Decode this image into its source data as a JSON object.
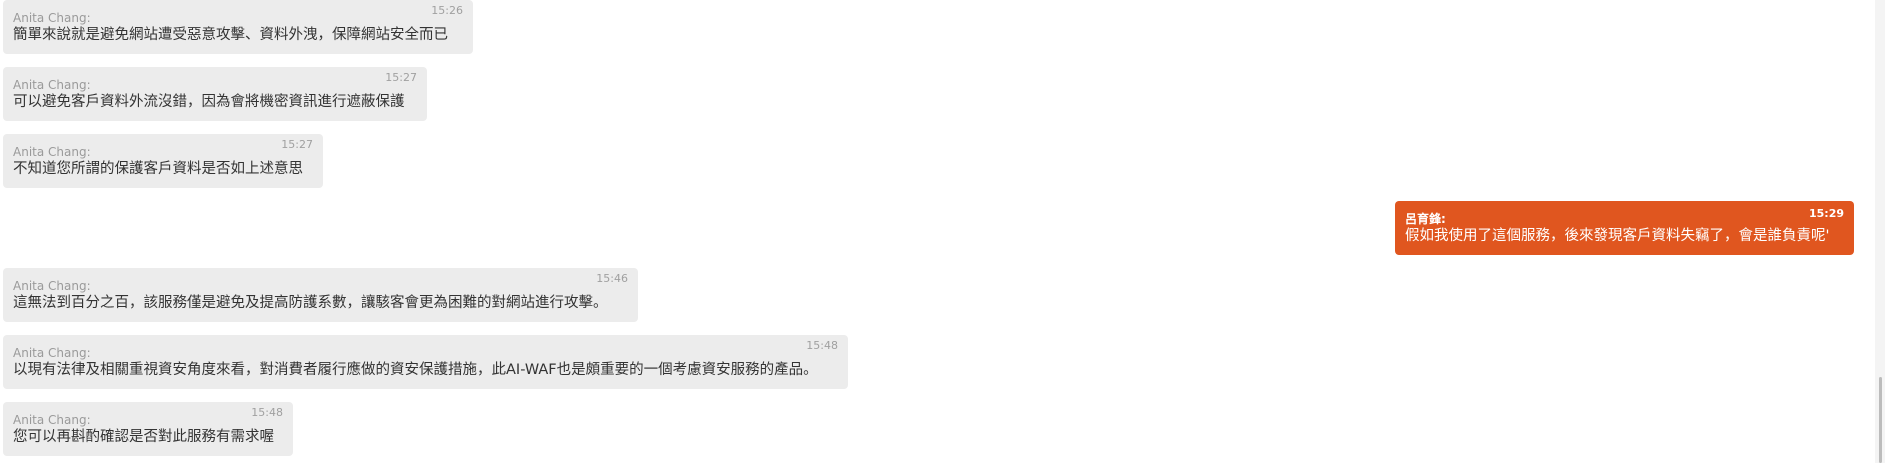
{
  "messages": [
    {
      "sender": "Anita Chang:",
      "time": "15:26",
      "text": "簡單來說就是避免網站遭受惡意攻擊、資料外洩，保障網站安全而已",
      "direction": "in"
    },
    {
      "sender": "Anita Chang:",
      "time": "15:27",
      "text": "可以避免客戶資料外流沒錯，因為會將機密資訊進行遮蔽保護",
      "direction": "in"
    },
    {
      "sender": "Anita Chang:",
      "time": "15:27",
      "text": "不知道您所謂的保護客戶資料是否如上述意思",
      "direction": "in"
    },
    {
      "sender": "呂育鋒:",
      "time": "15:29",
      "text": "假如我使用了這個服務，後來發現客戶資料失竊了，會是誰負責呢'",
      "direction": "out"
    },
    {
      "sender": "Anita Chang:",
      "time": "15:46",
      "text": "這無法到百分之百，該服務僅是避免及提高防護系數，讓駭客會更為困難的對網站進行攻擊。",
      "direction": "in"
    },
    {
      "sender": "Anita Chang:",
      "time": "15:48",
      "text": "以現有法律及相關重視資安角度來看，對消費者履行應做的資安保護措施，此AI-WAF也是頗重要的一個考慮資安服務的產品。",
      "direction": "in"
    },
    {
      "sender": "Anita Chang:",
      "time": "15:48",
      "text": "您可以再斟酌確認是否對此服務有需求喔",
      "direction": "in"
    }
  ],
  "colors": {
    "incoming_bg": "#ececec",
    "outgoing_bg": "#e0561f"
  }
}
